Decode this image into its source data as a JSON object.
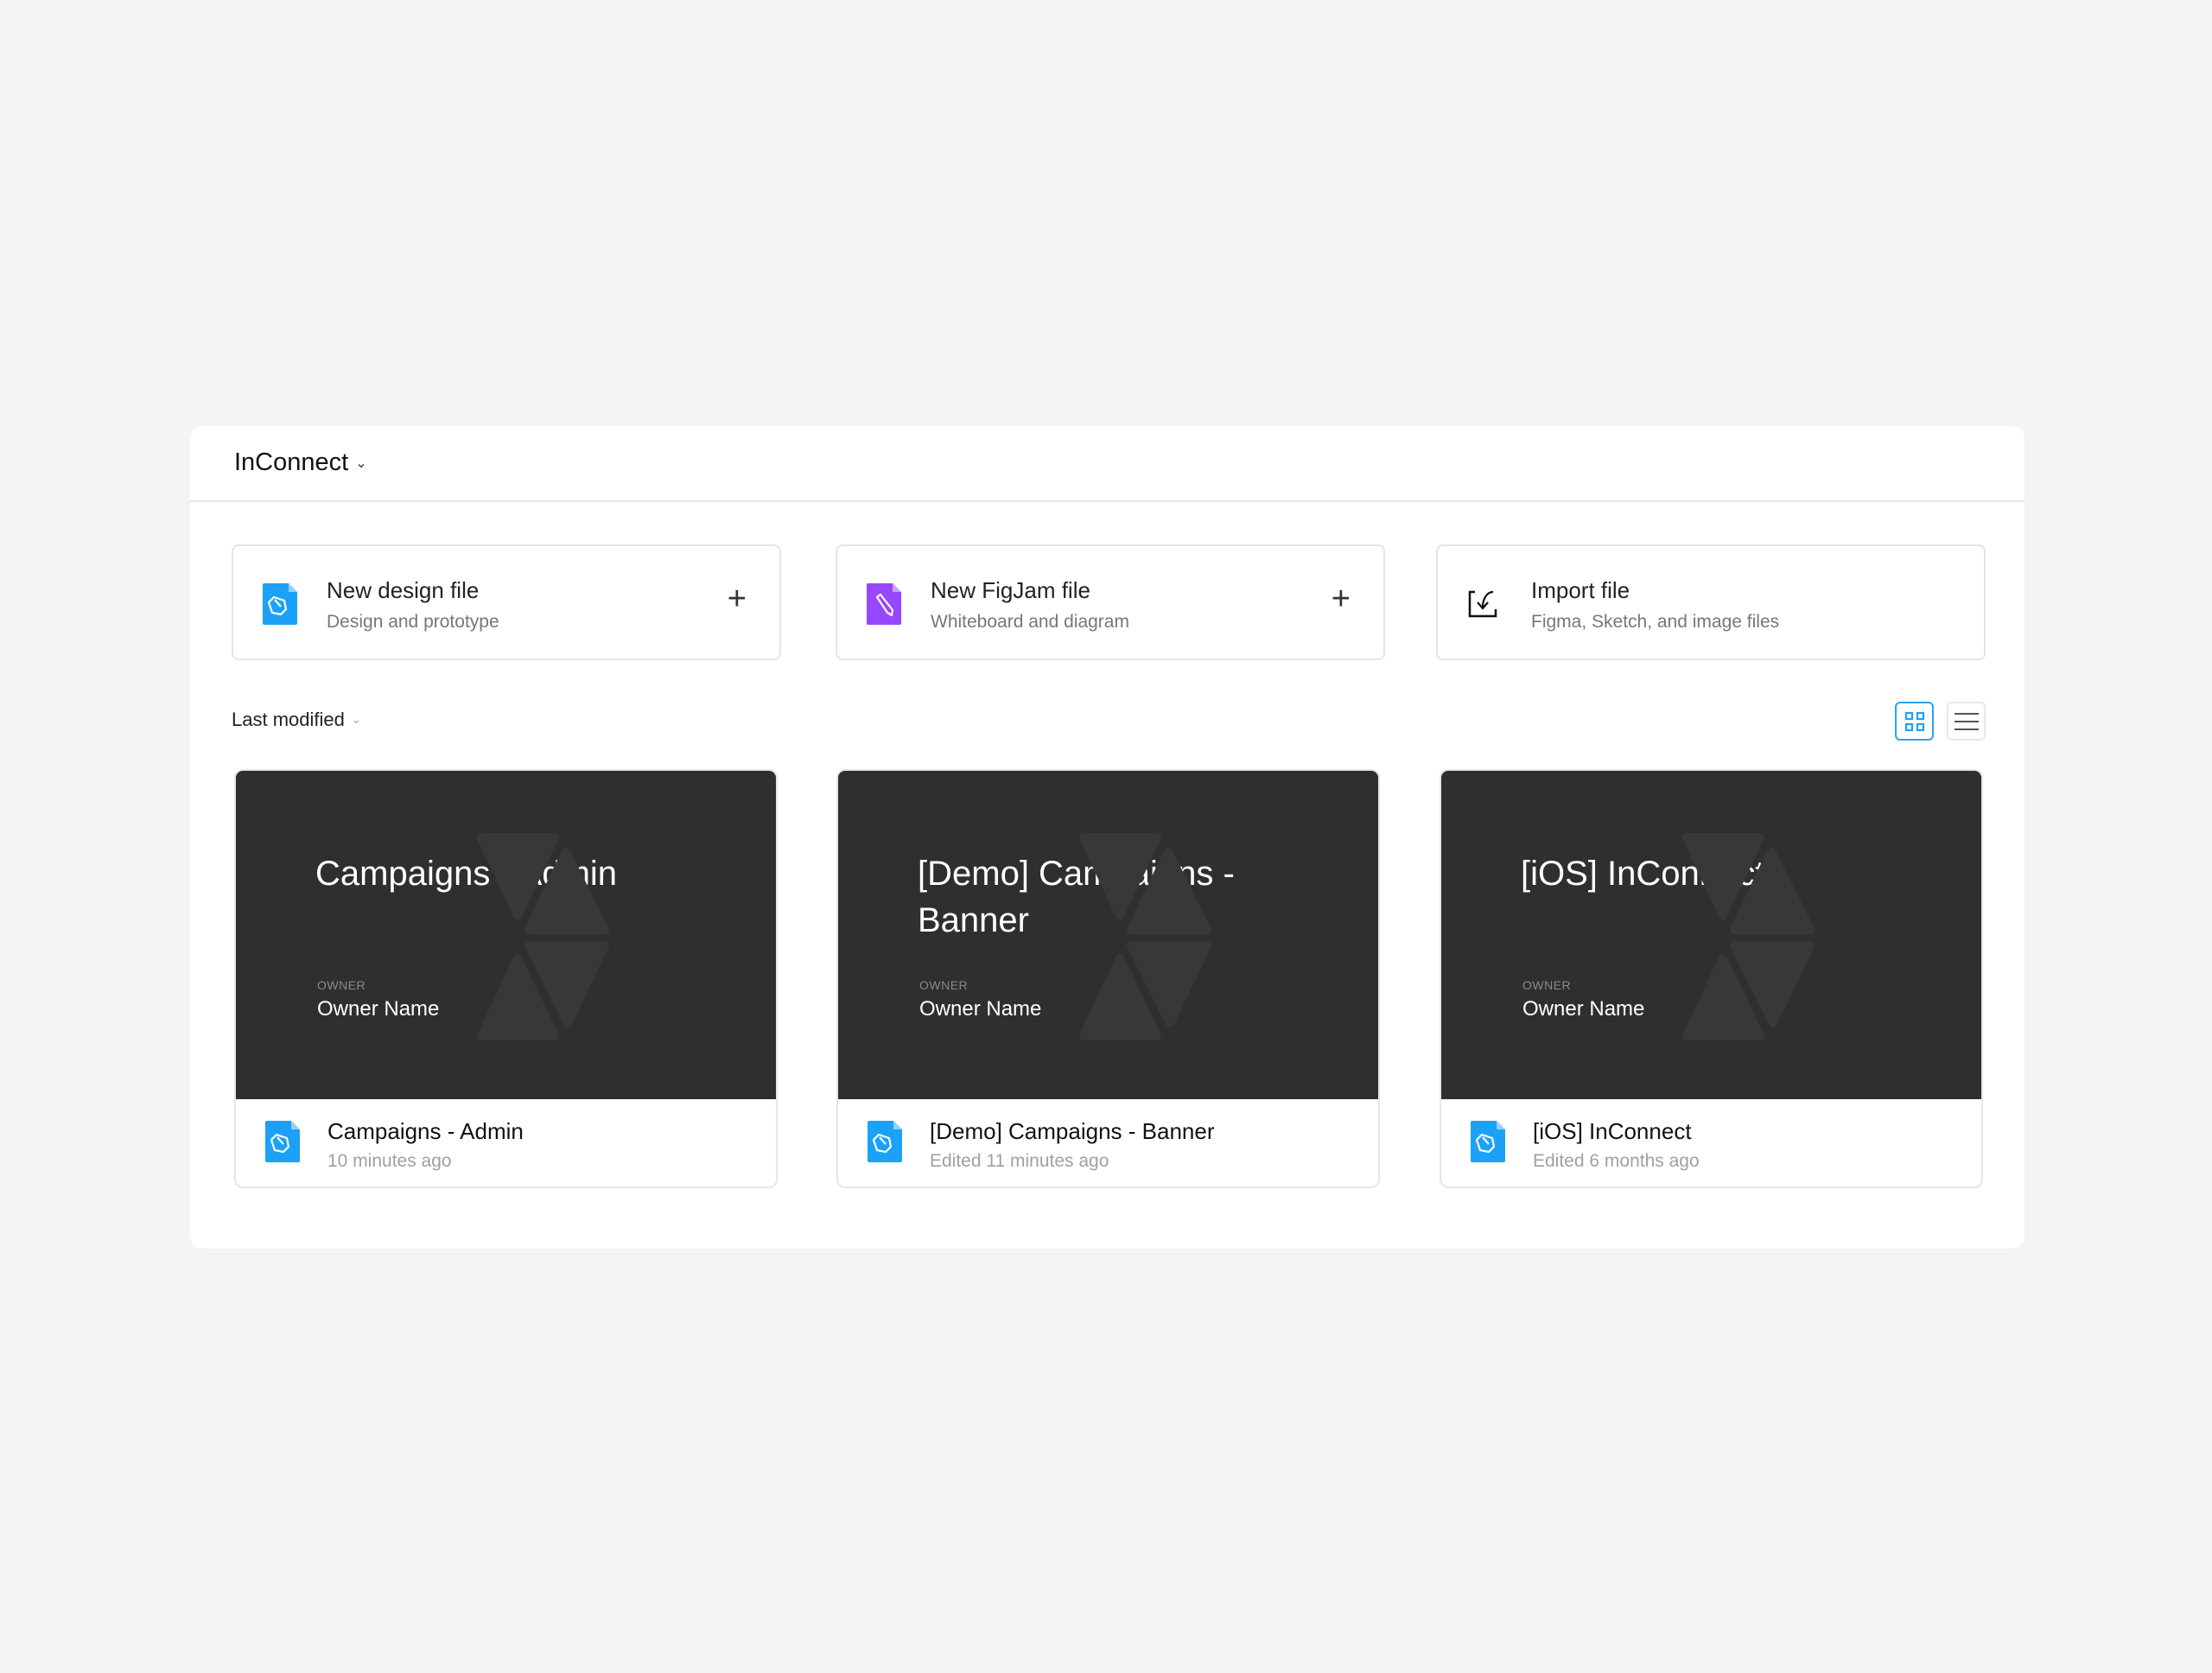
{
  "header": {
    "project": "InConnect"
  },
  "actions": [
    {
      "title": "New design file",
      "subtitle": "Design and prototype",
      "icon": "design-file-icon"
    },
    {
      "title": "New FigJam file",
      "subtitle": "Whiteboard and diagram",
      "icon": "figjam-file-icon"
    },
    {
      "title": "Import file",
      "subtitle": "Figma, Sketch, and image files",
      "icon": "import-icon"
    }
  ],
  "sort": {
    "label": "Last modified"
  },
  "view": {
    "selected": "grid"
  },
  "files": [
    {
      "thumb_title": "Campaigns - Admin",
      "owner_label": "OWNER",
      "owner": "Owner Name",
      "name": "Campaigns - Admin",
      "edited": "10 minutes ago"
    },
    {
      "thumb_title": "[Demo] Campaigns - Banner",
      "owner_label": "OWNER",
      "owner": "Owner Name",
      "name": "[Demo] Campaigns - Banner",
      "edited": "Edited 11 minutes ago"
    },
    {
      "thumb_title": "[iOS] InConnect",
      "owner_label": "OWNER",
      "owner": "Owner Name",
      "name": "[iOS] InConnect",
      "edited": "Edited 6 months ago"
    }
  ],
  "colors": {
    "design": "#1ba1f7",
    "figjam": "#9747ff",
    "thumb": "#2f2f2f"
  }
}
